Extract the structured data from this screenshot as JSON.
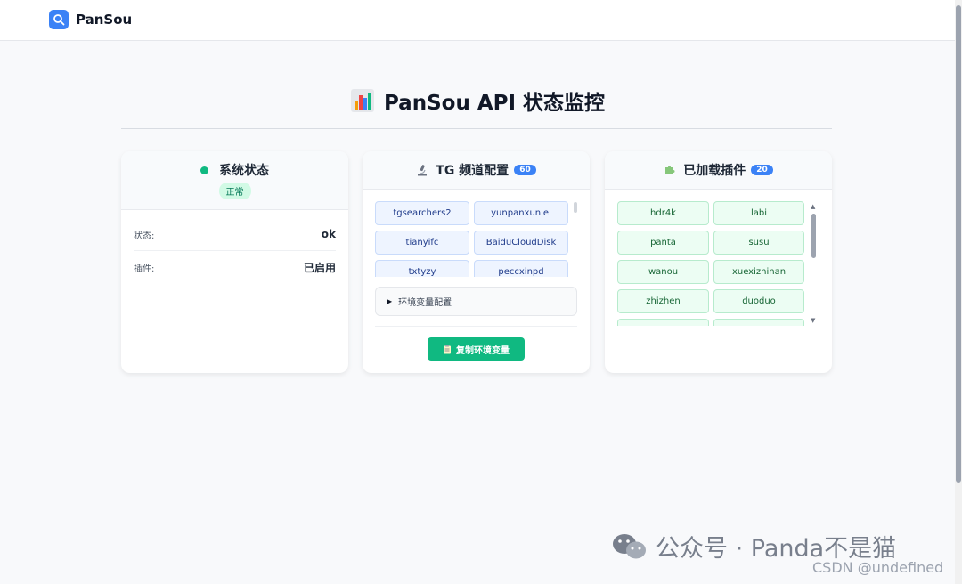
{
  "header": {
    "brand": "PanSou",
    "logo_icon": "search-icon"
  },
  "page": {
    "title": "PanSou API 状态监控",
    "title_icon": "bar-chart-icon"
  },
  "status_card": {
    "title": "系统状态",
    "badge": "正常",
    "rows": [
      {
        "label": "状态:",
        "value": "ok"
      },
      {
        "label": "插件:",
        "value": "已启用"
      }
    ]
  },
  "tg_card": {
    "title": "TG 频道配置",
    "count": "60",
    "icon": "microscope-icon",
    "channels": [
      "tgsearchers2",
      "yunpanxunlei",
      "tianyifc",
      "BaiduCloudDisk",
      "txtyzy",
      "peccxinpd"
    ],
    "env_label": "环境变量配置",
    "copy_button": "复制环境变量"
  },
  "plugin_card": {
    "title": "已加载插件",
    "count": "20",
    "icon": "puzzle-icon",
    "plugins": [
      "hdr4k",
      "labi",
      "panta",
      "susu",
      "wanou",
      "xuexizhinan",
      "zhizhen",
      "duoduo"
    ]
  },
  "watermark": {
    "text": "公众号 · Panda不是猫",
    "credit": "CSDN @undefined"
  },
  "colors": {
    "accent": "#3b82f6",
    "success": "#10b981"
  }
}
